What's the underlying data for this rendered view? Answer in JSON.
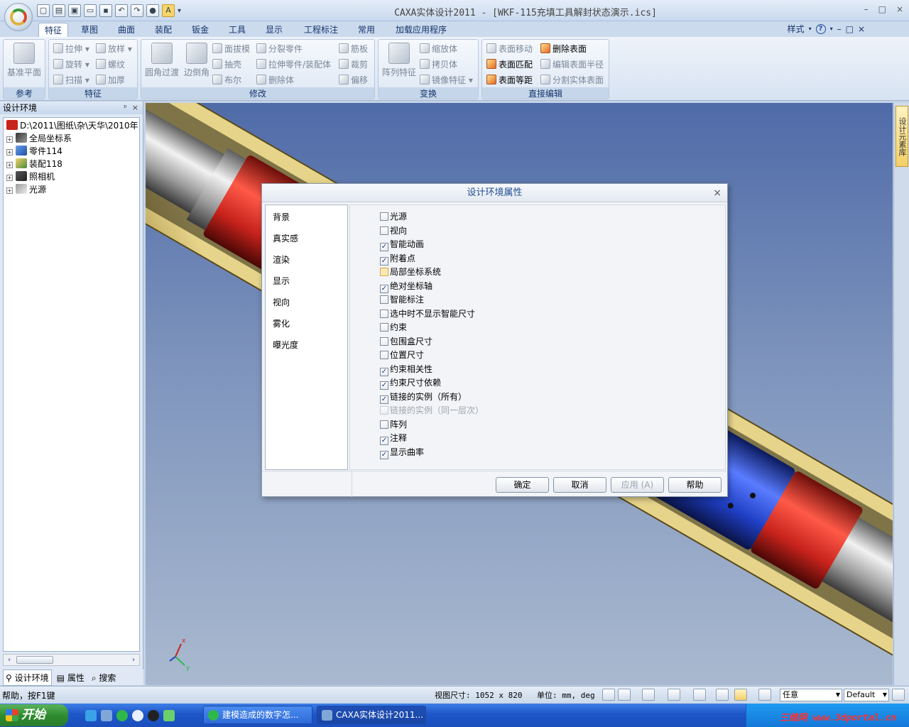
{
  "window": {
    "title": "CAXA实体设计2011 - [WKF-115充填工具解封状态演示.ics]",
    "controls": [
      "–",
      "□",
      "×"
    ]
  },
  "quick_access": [
    "new",
    "open-recent",
    "open-folder",
    "save-as",
    "open",
    "save",
    "undo",
    "redo",
    "render",
    "highlight",
    "▾"
  ],
  "ribbon": {
    "tabs": [
      "特征",
      "草图",
      "曲面",
      "装配",
      "钣金",
      "工具",
      "显示",
      "工程标注",
      "常用",
      "加载应用程序"
    ],
    "active_tab": "特征",
    "style_label": "样式",
    "help_glyph": "?",
    "mdi_controls": [
      "–",
      "□",
      "×"
    ],
    "groups": {
      "ref": {
        "label": "参考",
        "big": "基准平面"
      },
      "feature": {
        "label": "特征",
        "items": [
          "拉伸",
          "放样",
          "旋转",
          "螺纹",
          "扫描",
          "加厚"
        ]
      },
      "modify": {
        "label": "修改",
        "big1": "圆角过渡",
        "big2": "边倒角",
        "items": [
          "面拔模",
          "分裂零件",
          "筋板",
          "抽壳",
          "拉伸零件/装配体",
          "裁剪",
          "布尔",
          "删除体",
          "偏移"
        ]
      },
      "transform": {
        "label": "变换",
        "big": "阵列特征",
        "items": [
          "缩放体",
          "拷贝体",
          "镜像特征"
        ]
      },
      "direct_edit": {
        "label": "直接编辑",
        "items": [
          "表面移动",
          "删除表面",
          "表面匹配",
          "编辑表面半径",
          "表面等距",
          "分割实体表面"
        ]
      }
    }
  },
  "left_panel": {
    "title": "设计环境",
    "pin": "ᵖ",
    "close": "×",
    "tree": [
      {
        "label": "D:\\2011\\图纸\\杂\\天华\\2010年]",
        "icon": "document-icon",
        "expander": ""
      },
      {
        "label": "全局坐标系",
        "icon": "axes-icon",
        "expander": "+"
      },
      {
        "label": "零件114",
        "icon": "part-icon",
        "expander": "+"
      },
      {
        "label": "装配118",
        "icon": "assembly-icon",
        "expander": "+"
      },
      {
        "label": "照相机",
        "icon": "camera-icon",
        "expander": "+"
      },
      {
        "label": "光源",
        "icon": "light-icon",
        "expander": "+"
      }
    ],
    "scroll_left": "‹",
    "scroll_right": "›",
    "tabs": [
      "设计环境",
      "属性",
      "搜索"
    ]
  },
  "right_strip": {
    "tab": "设计元素库"
  },
  "dialog": {
    "title": "设计环境属性",
    "close": "×",
    "categories": [
      "背景",
      "真实感",
      "渲染",
      "显示",
      "视向",
      "雾化",
      "曝光度"
    ],
    "options": [
      {
        "label": "光源",
        "checked": false,
        "disabled": false,
        "focus": false
      },
      {
        "label": "视向",
        "checked": false,
        "disabled": false,
        "focus": false
      },
      {
        "label": "智能动画",
        "checked": true,
        "disabled": false,
        "focus": false
      },
      {
        "label": "附着点",
        "checked": true,
        "disabled": false,
        "focus": false
      },
      {
        "label": "局部坐标系统",
        "checked": false,
        "disabled": false,
        "focus": true
      },
      {
        "label": "绝对坐标轴",
        "checked": true,
        "disabled": false,
        "focus": false
      },
      {
        "label": "智能标注",
        "checked": false,
        "disabled": false,
        "focus": false
      },
      {
        "label": "选中时不显示智能尺寸",
        "checked": false,
        "disabled": false,
        "focus": false
      },
      {
        "label": "约束",
        "checked": false,
        "disabled": false,
        "focus": false
      },
      {
        "label": "包围盒尺寸",
        "checked": false,
        "disabled": false,
        "focus": false
      },
      {
        "label": "位置尺寸",
        "checked": false,
        "disabled": false,
        "focus": false
      },
      {
        "label": "约束相关性",
        "checked": true,
        "disabled": false,
        "focus": false
      },
      {
        "label": "约束尺寸依赖",
        "checked": true,
        "disabled": false,
        "focus": false
      },
      {
        "label": "链接的实例（所有）",
        "checked": true,
        "disabled": false,
        "focus": false
      },
      {
        "label": "链接的实例（同一层次）",
        "checked": false,
        "disabled": true,
        "focus": false
      },
      {
        "label": "阵列",
        "checked": false,
        "disabled": false,
        "focus": false
      },
      {
        "label": "注释",
        "checked": true,
        "disabled": false,
        "focus": false
      },
      {
        "label": "显示曲率",
        "checked": true,
        "disabled": false,
        "focus": false
      }
    ],
    "buttons": {
      "ok": "确定",
      "cancel": "取消",
      "apply": "应用 (A)",
      "help": "帮助"
    }
  },
  "viewport": {
    "axis_x": "x",
    "axis_y": "y"
  },
  "status": {
    "help": "帮助，按F1键",
    "view_size": "视图尺寸: 1052 x  820",
    "units": "单位: mm, deg",
    "select_mode": "任意",
    "render_style": "Default"
  },
  "taskbar": {
    "start": "开始",
    "tasks": [
      {
        "label": "建模造成的数字怎...",
        "active": false
      },
      {
        "label": "CAXA实体设计2011...",
        "active": true
      }
    ],
    "tray_text": "三维网 www.3dportal.cn"
  },
  "colors": {
    "viewport_top": "#4f6ba8",
    "tube": "#c9b26a",
    "red_part": "#c8231c",
    "purple_part": "#6a2c9e",
    "blue_part": "#1f3fc4",
    "dialog_title": "#1f4c8f"
  }
}
